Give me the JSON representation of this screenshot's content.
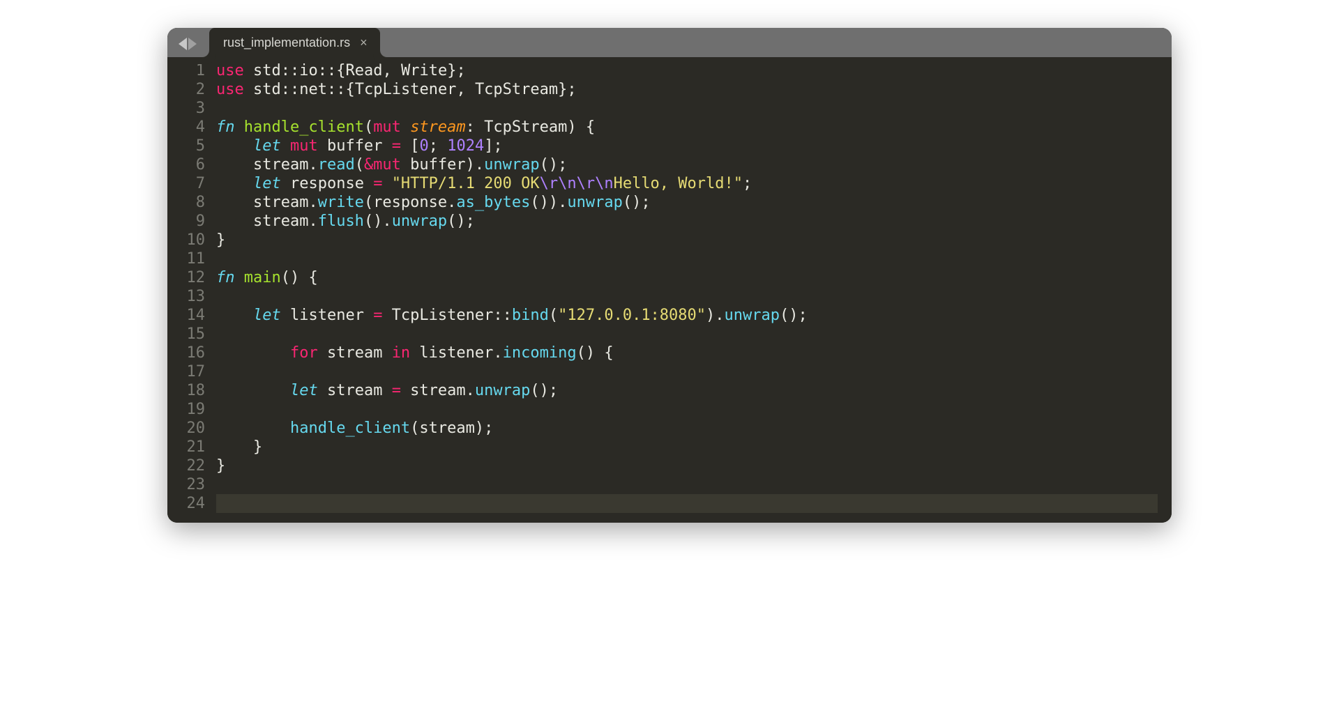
{
  "tab": {
    "title": "rust_implementation.rs",
    "close": "×"
  },
  "lineCount": 24,
  "activeLine": 24,
  "code": {
    "l1": [
      [
        "kw",
        "use"
      ],
      [
        "pn",
        " std"
      ],
      [
        "pn",
        "::"
      ],
      [
        "pn",
        "io"
      ],
      [
        "pn",
        "::"
      ],
      [
        "pn",
        "{"
      ],
      [
        "pn",
        "Read"
      ],
      [
        "pn",
        ", "
      ],
      [
        "pn",
        "Write"
      ],
      [
        "pn",
        "};"
      ]
    ],
    "l2": [
      [
        "kw",
        "use"
      ],
      [
        "pn",
        " std"
      ],
      [
        "pn",
        "::"
      ],
      [
        "pn",
        "net"
      ],
      [
        "pn",
        "::"
      ],
      [
        "pn",
        "{"
      ],
      [
        "pn",
        "TcpListener"
      ],
      [
        "pn",
        ", "
      ],
      [
        "pn",
        "TcpStream"
      ],
      [
        "pn",
        "};"
      ]
    ],
    "l3": [],
    "l4": [
      [
        "fnkw",
        "fn"
      ],
      [
        "pn",
        " "
      ],
      [
        "fnname",
        "handle_client"
      ],
      [
        "pn",
        "("
      ],
      [
        "kw",
        "mut"
      ],
      [
        "pn",
        " "
      ],
      [
        "param",
        "stream"
      ],
      [
        "pn",
        ": "
      ],
      [
        "pn",
        "TcpStream"
      ],
      [
        "pn",
        ") {"
      ]
    ],
    "l5": [
      [
        "pn",
        "    "
      ],
      [
        "let",
        "let"
      ],
      [
        "pn",
        " "
      ],
      [
        "kw",
        "mut"
      ],
      [
        "pn",
        " buffer "
      ],
      [
        "kw",
        "="
      ],
      [
        "pn",
        " ["
      ],
      [
        "num",
        "0"
      ],
      [
        "pn",
        "; "
      ],
      [
        "num",
        "1024"
      ],
      [
        "pn",
        "];"
      ]
    ],
    "l6": [
      [
        "pn",
        "    stream."
      ],
      [
        "ty",
        "read"
      ],
      [
        "pn",
        "("
      ],
      [
        "kw",
        "&mut"
      ],
      [
        "pn",
        " buffer)."
      ],
      [
        "ty",
        "unwrap"
      ],
      [
        "pn",
        "();"
      ]
    ],
    "l7": [
      [
        "pn",
        "    "
      ],
      [
        "let",
        "let"
      ],
      [
        "pn",
        " response "
      ],
      [
        "kw",
        "="
      ],
      [
        "pn",
        " "
      ],
      [
        "str",
        "\"HTTP/1.1 200 OK"
      ],
      [
        "esc",
        "\\r\\n\\r\\n"
      ],
      [
        "str",
        "Hello, World!\""
      ],
      [
        "pn",
        ";"
      ]
    ],
    "l8": [
      [
        "pn",
        "    stream."
      ],
      [
        "ty",
        "write"
      ],
      [
        "pn",
        "(response."
      ],
      [
        "ty",
        "as_bytes"
      ],
      [
        "pn",
        "())."
      ],
      [
        "ty",
        "unwrap"
      ],
      [
        "pn",
        "();"
      ]
    ],
    "l9": [
      [
        "pn",
        "    stream."
      ],
      [
        "ty",
        "flush"
      ],
      [
        "pn",
        "()."
      ],
      [
        "ty",
        "unwrap"
      ],
      [
        "pn",
        "();"
      ]
    ],
    "l10": [
      [
        "pn",
        "}"
      ]
    ],
    "l11": [],
    "l12": [
      [
        "fnkw",
        "fn"
      ],
      [
        "pn",
        " "
      ],
      [
        "fnname",
        "main"
      ],
      [
        "pn",
        "() {"
      ]
    ],
    "l13": [],
    "l14": [
      [
        "pn",
        "    "
      ],
      [
        "let",
        "let"
      ],
      [
        "pn",
        " listener "
      ],
      [
        "kw",
        "="
      ],
      [
        "pn",
        " TcpListener::"
      ],
      [
        "ty",
        "bind"
      ],
      [
        "pn",
        "("
      ],
      [
        "str",
        "\"127.0.0.1:8080\""
      ],
      [
        "pn",
        ")."
      ],
      [
        "ty",
        "unwrap"
      ],
      [
        "pn",
        "();"
      ]
    ],
    "l15": [],
    "l16": [
      [
        "pn",
        "        "
      ],
      [
        "kw",
        "for"
      ],
      [
        "pn",
        " stream "
      ],
      [
        "kw",
        "in"
      ],
      [
        "pn",
        " listener."
      ],
      [
        "ty",
        "incoming"
      ],
      [
        "pn",
        "() {"
      ]
    ],
    "l17": [],
    "l18": [
      [
        "pn",
        "        "
      ],
      [
        "let",
        "let"
      ],
      [
        "pn",
        " stream "
      ],
      [
        "kw",
        "="
      ],
      [
        "pn",
        " stream."
      ],
      [
        "ty",
        "unwrap"
      ],
      [
        "pn",
        "();"
      ]
    ],
    "l19": [],
    "l20": [
      [
        "pn",
        "        "
      ],
      [
        "ty",
        "handle_client"
      ],
      [
        "pn",
        "(stream);"
      ]
    ],
    "l21": [
      [
        "pn",
        "    }"
      ]
    ],
    "l22": [
      [
        "pn",
        "}"
      ]
    ],
    "l23": [],
    "l24": []
  }
}
